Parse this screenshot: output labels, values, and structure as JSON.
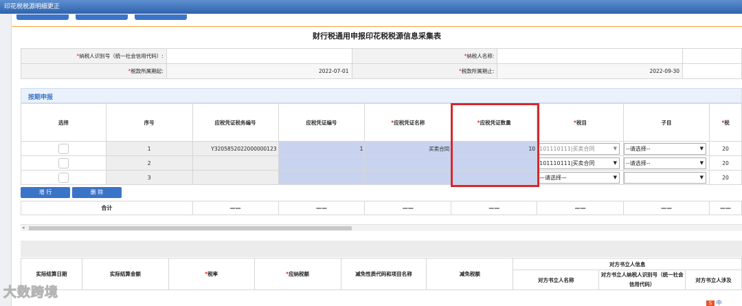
{
  "window": {
    "title": "印花税税源明细更正"
  },
  "form": {
    "title": "财行税通用申报印花税税源信息采集表",
    "taxpayer_id_label": "纳税人识别号（统一社会信用代码）:",
    "taxpayer_id_value": "",
    "taxpayer_name_label": "纳税人名称:",
    "taxpayer_name_value": "",
    "period_start_label": "税款所属期起:",
    "period_start_value": "2022-07-01",
    "period_end_label": "税款所属期止:",
    "period_end_value": "2022-09-30"
  },
  "section": {
    "title": "按期申报"
  },
  "grid": {
    "headers": [
      "选择",
      "序号",
      "应税凭证税务编号",
      "应税凭证编号",
      "应税凭证名称",
      "应税凭证数量",
      "税目",
      "子目",
      "税"
    ],
    "required_headers": [
      false,
      false,
      false,
      false,
      true,
      true,
      true,
      false,
      true
    ],
    "rows": [
      {
        "seq": "1",
        "tax_no": "Y3205852022000000123",
        "voucher_no": "1",
        "voucher_name": "买卖合同",
        "qty": "10",
        "item": "101110111|买卖合同",
        "sub": "--请选择--",
        "last": "20"
      },
      {
        "seq": "2",
        "tax_no": "",
        "voucher_no": "",
        "voucher_name": "",
        "qty": "",
        "item": "101110111|买卖合同",
        "sub": "--请选择--",
        "last": "20"
      },
      {
        "seq": "3",
        "tax_no": "",
        "voucher_no": "",
        "voucher_name": "",
        "qty": "",
        "item": "—请选择—",
        "sub": "",
        "last": "20"
      }
    ]
  },
  "buttons": {
    "add_row": "增 行",
    "delete": "删 除"
  },
  "total": {
    "label": "合计",
    "dash": "——"
  },
  "lower": {
    "headers": [
      "实际结算日期",
      "实际结算金额",
      "税率",
      "应纳税额",
      "减免性质代码和项目名称",
      "减免税额"
    ],
    "required": [
      false,
      false,
      true,
      true,
      false,
      false
    ],
    "group_title": "对方书立人信息",
    "sub_headers": [
      "对方书立人名称",
      "对方书立人纳税人识别号（统一社会信用代码）",
      "对方书立人涉及"
    ]
  },
  "watermark": {
    "text": "大数跨境"
  },
  "corner": {
    "text": "中"
  }
}
